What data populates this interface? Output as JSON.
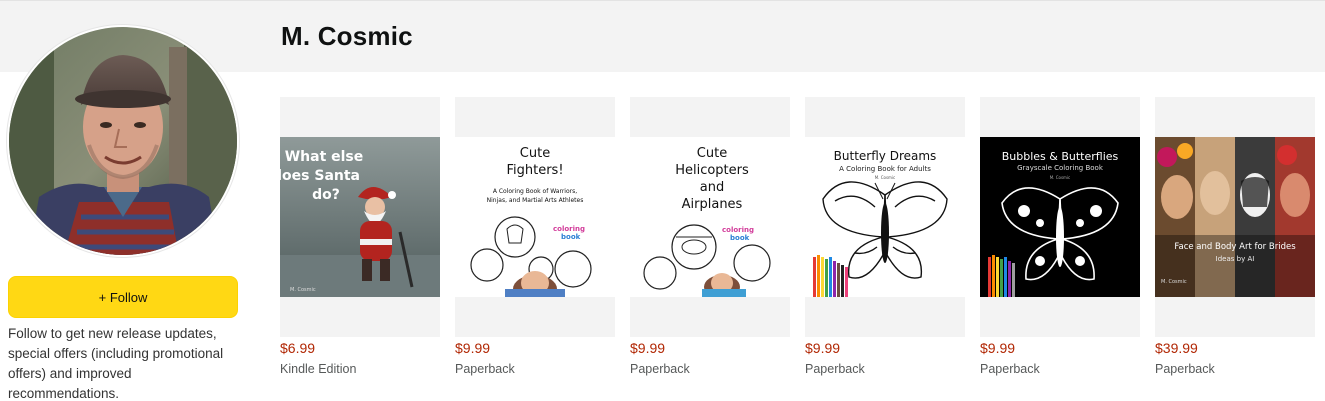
{
  "author": {
    "name": "M. Cosmic",
    "follow_label": "+ Follow",
    "follow_note": "Follow to get new release updates, special offers (including promotional offers) and improved recommendations."
  },
  "books": [
    {
      "cover_lines": [
        "What else",
        "does Santa",
        "do?"
      ],
      "cover_author": "M. Cosmic",
      "price": "$6.99",
      "format": "Kindle Edition"
    },
    {
      "cover_lines": [
        "Cute",
        "Fighters!"
      ],
      "cover_subtitle": [
        "A Coloring Book of Warriors,",
        "Ninjas, and Martial Arts Athletes"
      ],
      "cover_badge": [
        "coloring",
        "book"
      ],
      "price": "$9.99",
      "format": "Paperback"
    },
    {
      "cover_lines": [
        "Cute",
        "Helicopters",
        "and",
        "Airplanes"
      ],
      "cover_badge": [
        "coloring",
        "book"
      ],
      "price": "$9.99",
      "format": "Paperback"
    },
    {
      "cover_lines": [
        "Butterfly Dreams"
      ],
      "cover_subtitle": [
        "A Coloring Book for Adults"
      ],
      "cover_author": "M. Cosmic",
      "price": "$9.99",
      "format": "Paperback"
    },
    {
      "cover_lines": [
        "Bubbles & Butterflies"
      ],
      "cover_subtitle": [
        "Grayscale Coloring Book"
      ],
      "cover_author": "M. Cosmic",
      "price": "$9.99",
      "format": "Paperback"
    },
    {
      "cover_lines": [
        "Face and Body Art for Brides"
      ],
      "cover_subtitle": [
        "Ideas by AI"
      ],
      "cover_author": "M. Cosmic",
      "price": "$39.99",
      "format": "Paperback"
    }
  ],
  "colors": {
    "header_band": "#f3f3f3",
    "follow_button": "#ffd814",
    "price": "#b12704",
    "format": "#565959"
  }
}
